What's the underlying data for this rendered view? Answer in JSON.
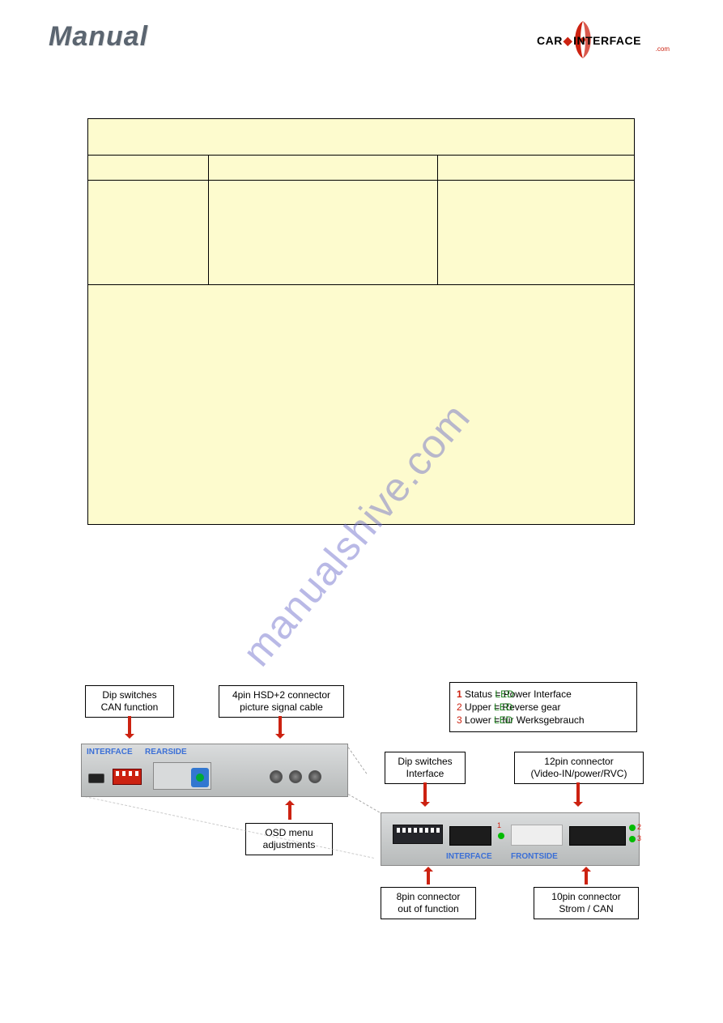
{
  "header": {
    "manual": "Manual",
    "brand_car": "CAR",
    "brand_inter": "INTERFACE",
    "brand_com": ".com"
  },
  "watermark": "manualshive.com",
  "labels": {
    "dip_can_l1": "Dip switches",
    "dip_can_l2": "CAN function",
    "hsd_l1": "4pin HSD+2 connector",
    "hsd_l2": "picture signal cable",
    "osd_l1": "OSD menu",
    "osd_l2": "adjustments",
    "dip_if_l1": "Dip switches",
    "dip_if_l2": "Interface",
    "p12_l1": "12pin connector",
    "p12_l2": "(Video-IN/power/RVC)",
    "p8_l1": "8pin connector",
    "p8_l2": "out of function",
    "p10_l1": "10pin connector",
    "p10_l2": "Strom / CAN"
  },
  "status": {
    "n1": "1",
    "n2": "2",
    "n3": "3",
    "t1a": "Status ",
    "led": "LED",
    "t1b": "   = Power Interface",
    "t2a": "Upper ",
    "t2b": "     = Reverse gear",
    "t3a": "Lower ",
    "t3b": "   = für Werksgebrauch"
  },
  "device": {
    "rear_tag_l": "INTERFACE",
    "rear_tag_r": "REARSIDE",
    "front_tag_l": "INTERFACE",
    "front_tag_r": "FRONTSIDE",
    "led1": "1",
    "led2": "2",
    "led3": "3"
  }
}
